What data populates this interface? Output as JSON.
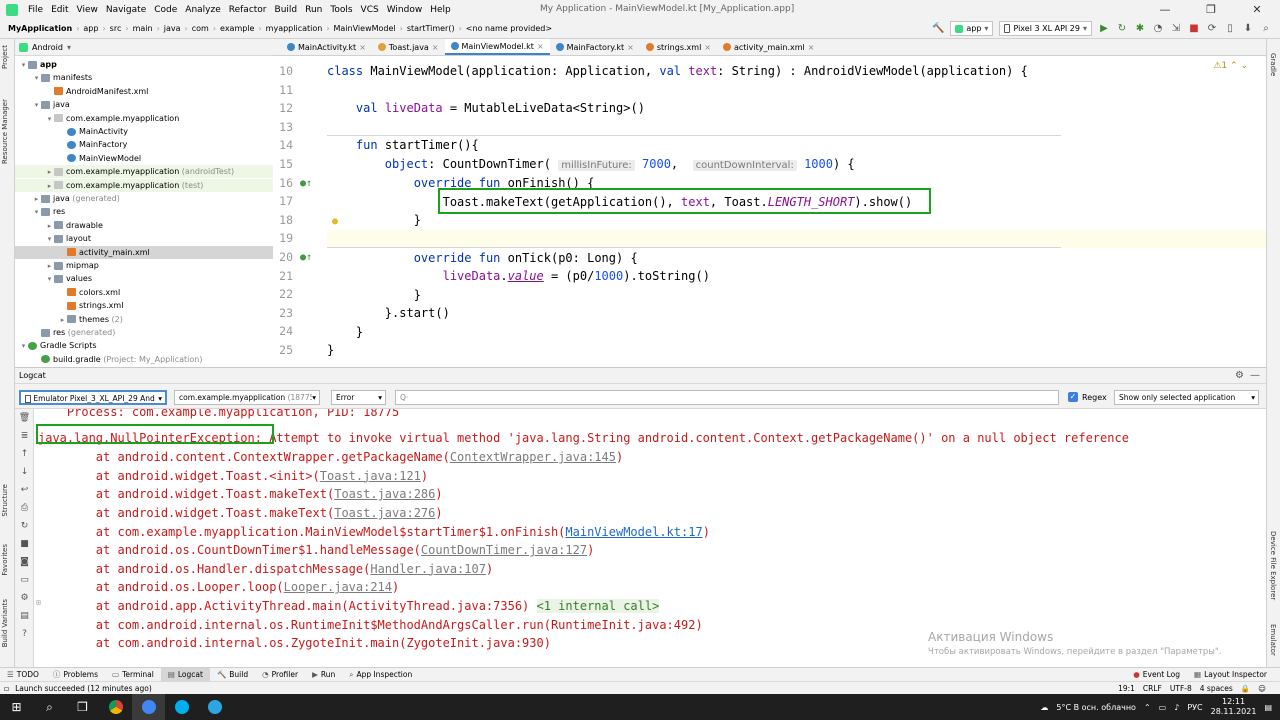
{
  "menubar": {
    "items": [
      "File",
      "Edit",
      "View",
      "Navigate",
      "Code",
      "Analyze",
      "Refactor",
      "Build",
      "Run",
      "Tools",
      "VCS",
      "Window",
      "Help"
    ],
    "window_title": "My Application - MainViewModel.kt [My_Application.app]"
  },
  "navbar": {
    "crumbs": [
      "MyApplication",
      "app",
      "src",
      "main",
      "java",
      "com",
      "example",
      "myapplication",
      "MainViewModel",
      "startTimer()",
      "<no name provided>"
    ],
    "run_config": "app",
    "device": "Pixel 3 XL API 29"
  },
  "project": {
    "view": "Android",
    "tree": [
      {
        "label": "app",
        "indent": 0,
        "icon": "folder",
        "arrow": "▾",
        "bold": true
      },
      {
        "label": "manifests",
        "indent": 1,
        "icon": "folder",
        "arrow": "▾"
      },
      {
        "label": "AndroidManifest.xml",
        "indent": 2,
        "icon": "xml",
        "arrow": ""
      },
      {
        "label": "java",
        "indent": 1,
        "icon": "folder",
        "arrow": "▾"
      },
      {
        "label": "com.example.myapplication",
        "indent": 2,
        "icon": "pkg",
        "arrow": "▾"
      },
      {
        "label": "MainActivity",
        "indent": 3,
        "icon": "kt",
        "arrow": ""
      },
      {
        "label": "MainFactory",
        "indent": 3,
        "icon": "kt",
        "arrow": ""
      },
      {
        "label": "MainViewModel",
        "indent": 3,
        "icon": "kt",
        "arrow": ""
      },
      {
        "label": "com.example.myapplication",
        "suffix": " (androidTest)",
        "indent": 2,
        "icon": "pkg",
        "arrow": "▸",
        "hl": true
      },
      {
        "label": "com.example.myapplication",
        "suffix": " (test)",
        "indent": 2,
        "icon": "pkg",
        "arrow": "▸",
        "hl": true
      },
      {
        "label": "java",
        "suffix": " (generated)",
        "indent": 1,
        "icon": "folder",
        "arrow": "▸"
      },
      {
        "label": "res",
        "indent": 1,
        "icon": "folder",
        "arrow": "▾"
      },
      {
        "label": "drawable",
        "indent": 2,
        "icon": "folder",
        "arrow": "▸"
      },
      {
        "label": "layout",
        "indent": 2,
        "icon": "folder",
        "arrow": "▾"
      },
      {
        "label": "activity_main.xml",
        "indent": 3,
        "icon": "xml",
        "arrow": "",
        "sel": true
      },
      {
        "label": "mipmap",
        "indent": 2,
        "icon": "folder",
        "arrow": "▸"
      },
      {
        "label": "values",
        "indent": 2,
        "icon": "folder",
        "arrow": "▾"
      },
      {
        "label": "colors.xml",
        "indent": 3,
        "icon": "xml",
        "arrow": ""
      },
      {
        "label": "strings.xml",
        "indent": 3,
        "icon": "xml",
        "arrow": ""
      },
      {
        "label": "themes",
        "suffix": " (2)",
        "indent": 3,
        "icon": "folder",
        "arrow": "▸"
      },
      {
        "label": "res",
        "suffix": " (generated)",
        "indent": 1,
        "icon": "folder",
        "arrow": ""
      },
      {
        "label": "Gradle Scripts",
        "indent": 0,
        "icon": "gradle",
        "arrow": "▾"
      },
      {
        "label": "build.gradle",
        "suffix": " (Project: My_Application)",
        "indent": 1,
        "icon": "gradle",
        "arrow": ""
      }
    ]
  },
  "tabs": [
    {
      "label": "MainActivity.kt",
      "color": "#3e86c5"
    },
    {
      "label": "Toast.java",
      "color": "#e0a13a"
    },
    {
      "label": "MainViewModel.kt",
      "color": "#3e86c5",
      "active": true
    },
    {
      "label": "MainFactory.kt",
      "color": "#3e86c5"
    },
    {
      "label": "strings.xml",
      "color": "#e27a2c"
    },
    {
      "label": "activity_main.xml",
      "color": "#e27a2c"
    }
  ],
  "editor": {
    "line_numbers": [
      "10",
      "11",
      "12",
      "13",
      "14",
      "15",
      "16",
      "17",
      "18",
      "19",
      "20",
      "21",
      "22",
      "23",
      "24",
      "25"
    ],
    "warning_count": "1",
    "hint_millis": "millisInFuture:",
    "hint_interval": "countDownInterval:"
  },
  "logcat": {
    "title": "Logcat",
    "device": "Emulator Pixel_3_XL_API_29 And",
    "process": "com.example.myapplication",
    "process_pid": " (18775",
    "level": "Error",
    "search_placeholder": "Q·",
    "regex_label": "Regex",
    "filter": "Show only selected application",
    "lines": [
      "    Process: com.example.myapplication, PID: 18775",
      "",
      "        at android.content.ContextWrapper.getPackageName(",
      "        at android.widget.Toast.<init>(",
      "        at android.widget.Toast.makeText(",
      "        at android.widget.Toast.makeText(",
      "        at com.example.myapplication.MainViewModel$startTimer$1.onFinish(",
      "        at android.os.CountDownTimer$1.handleMessage(",
      "        at android.os.Handler.dispatchMessage(",
      "        at android.os.Looper.loop(",
      "        at android.app.ActivityThread.main(ActivityThread.java:7356) ",
      "        at com.android.internal.os.RuntimeInit$MethodAndArgsCaller.run(RuntimeInit.java:492)",
      "        at com.android.internal.os.ZygoteInit.main(ZygoteInit.java:930)"
    ],
    "links": [
      "",
      "",
      "ContextWrapper.java:145",
      "Toast.java:121",
      "Toast.java:286",
      "Toast.java:276",
      "MainViewModel.kt:17",
      "CountDownTimer.java:127",
      "Handler.java:107",
      "Looper.java:214",
      "",
      "",
      ""
    ],
    "exception": "java.lang.NullPointerException:",
    "exception_msg": " Attempt to invoke virtual method 'java.lang.String android.content.Context.getPackageName()' on a null object reference",
    "internal_call": "<1 internal call>"
  },
  "watermark": {
    "title": "Активация Windows",
    "subtitle": "Чтобы активировать Windows, перейдите в раздел \"Параметры\"."
  },
  "toolwindows": [
    "TODO",
    "Problems",
    "Terminal",
    "Logcat",
    "Build",
    "Profiler",
    "Run",
    "App Inspection"
  ],
  "toolwindows_right": [
    "Event Log",
    "Layout Inspector"
  ],
  "status": {
    "message": "Launch succeeded (12 minutes ago)",
    "position": "19:1",
    "line_sep": "CRLF",
    "encoding": "UTF-8",
    "indent": "4 spaces"
  },
  "side_labels": {
    "project": "Project",
    "resource_manager": "Resource Manager",
    "structure": "Structure",
    "favorites": "Favorites",
    "build_variants": "Build Variants",
    "gradle": "Gradle",
    "device_file_explorer": "Device File Explorer",
    "emulator": "Emulator"
  },
  "taskbar": {
    "weather": "5°C  В осн. облачно",
    "lang": "РУС",
    "time": "12:11",
    "date": "28.11.2021"
  }
}
